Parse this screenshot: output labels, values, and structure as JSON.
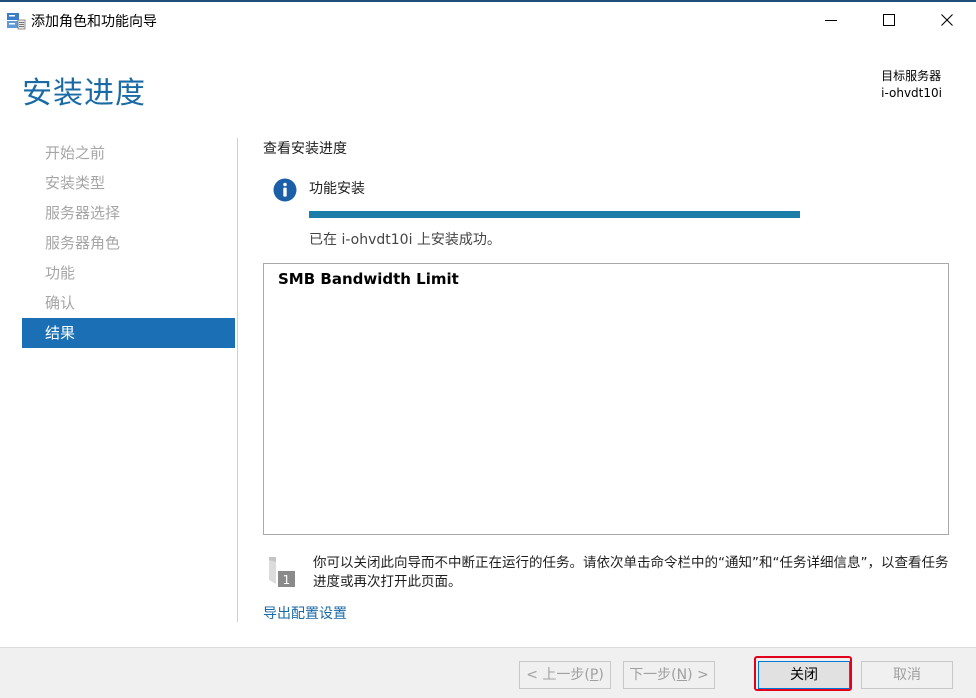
{
  "window": {
    "title": "添加角色和功能向导",
    "controls": {
      "minimize": "—",
      "maximize": "☐",
      "close": "✕"
    }
  },
  "header": {
    "title": "安装进度",
    "target_label": "目标服务器",
    "target_value": "i-ohvdt10i"
  },
  "nav": {
    "items": [
      {
        "label": "开始之前",
        "state": "disabled"
      },
      {
        "label": "安装类型",
        "state": "disabled"
      },
      {
        "label": "服务器选择",
        "state": "disabled"
      },
      {
        "label": "服务器角色",
        "state": "disabled"
      },
      {
        "label": "功能",
        "state": "disabled"
      },
      {
        "label": "确认",
        "state": "disabled"
      },
      {
        "label": "结果",
        "state": "active"
      }
    ]
  },
  "main": {
    "section_title": "查看安装进度",
    "feature_label": "功能安装",
    "progress": 1.0,
    "success_text": "已在 i-ohvdt10i 上安装成功。",
    "results": [
      "SMB Bandwidth Limit"
    ],
    "note": "你可以关闭此向导而不中断正在运行的任务。请依次单击命令栏中的“通知”和“任务详细信息”，以查看任务进度或再次打开此页面。",
    "note_badge": "1",
    "export_link": "导出配置设置"
  },
  "footer": {
    "prev": {
      "label_pre": "< 上一步(",
      "mnemonic": "P",
      "label_post": ")"
    },
    "next": {
      "label_pre": "下一步(",
      "mnemonic": "N",
      "label_post": ") >"
    },
    "close": "关闭",
    "cancel": "取消"
  },
  "colors": {
    "accent": "#1a6aa5",
    "nav_active": "#1a6fb5",
    "progress": "#1b7ea8",
    "highlight": "#e3001b"
  }
}
